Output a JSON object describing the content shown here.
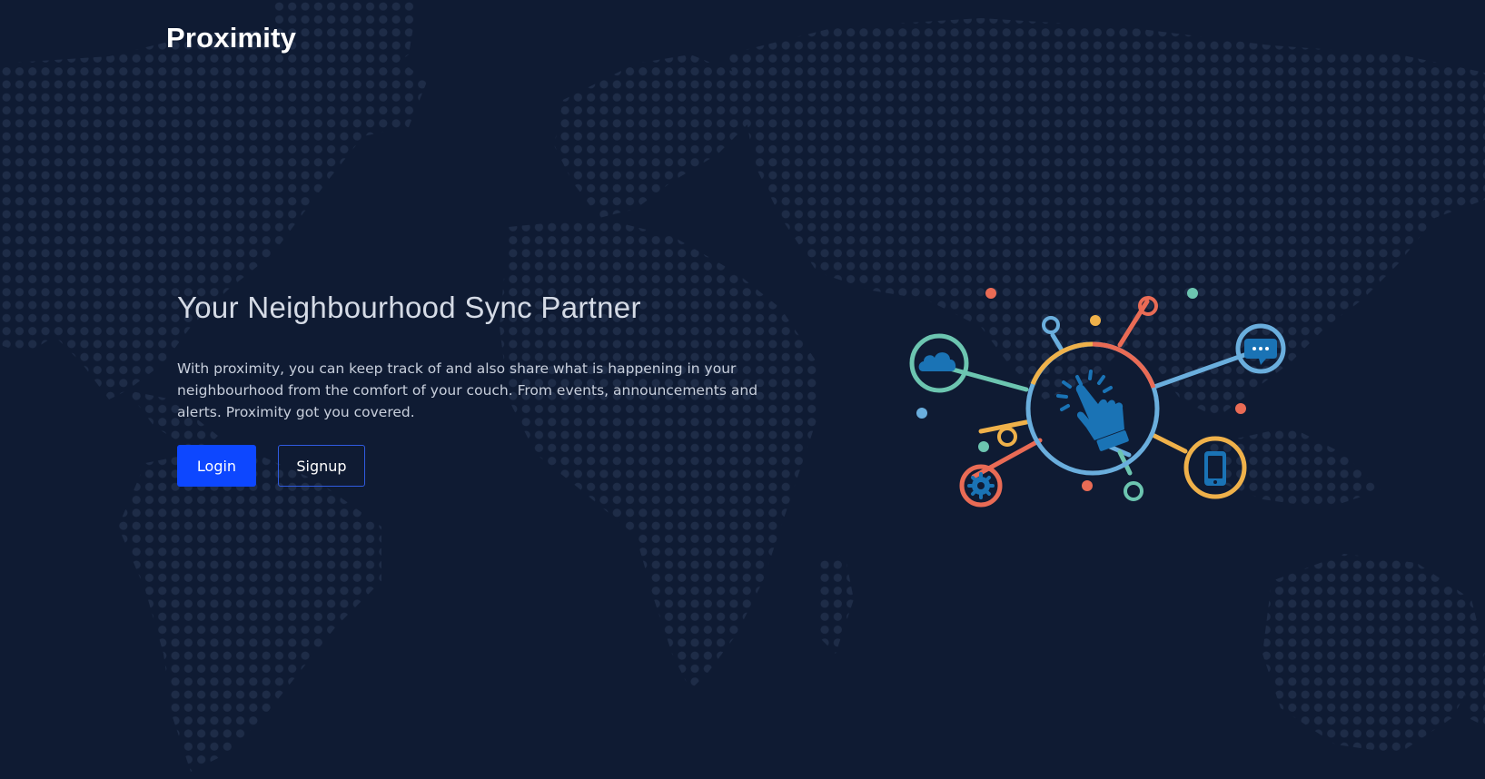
{
  "brand": {
    "name": "Proximity"
  },
  "hero": {
    "headline": "Your Neighbourhood Sync Partner",
    "description": "With proximity, you can keep track of and also share what is happening in your neighbourhood from the comfort of your couch. From events, announcements and alerts. Proximity got you covered.",
    "login_label": "Login",
    "signup_label": "Signup"
  },
  "illustration": {
    "icons": [
      "pointer-hand-icon",
      "cloud-icon",
      "chat-icon",
      "phone-icon",
      "gear-icon"
    ],
    "colors": {
      "teal": "#6cc5b0",
      "blue": "#6aaedd",
      "orange": "#e96b55",
      "yellow": "#efb14a",
      "icon_blue": "#1a73b5"
    }
  },
  "theme": {
    "background": "#0f1b33",
    "dot_color": "#1e2c47",
    "primary_button": "#0d47ff",
    "outline_button": "#2f5be0"
  }
}
